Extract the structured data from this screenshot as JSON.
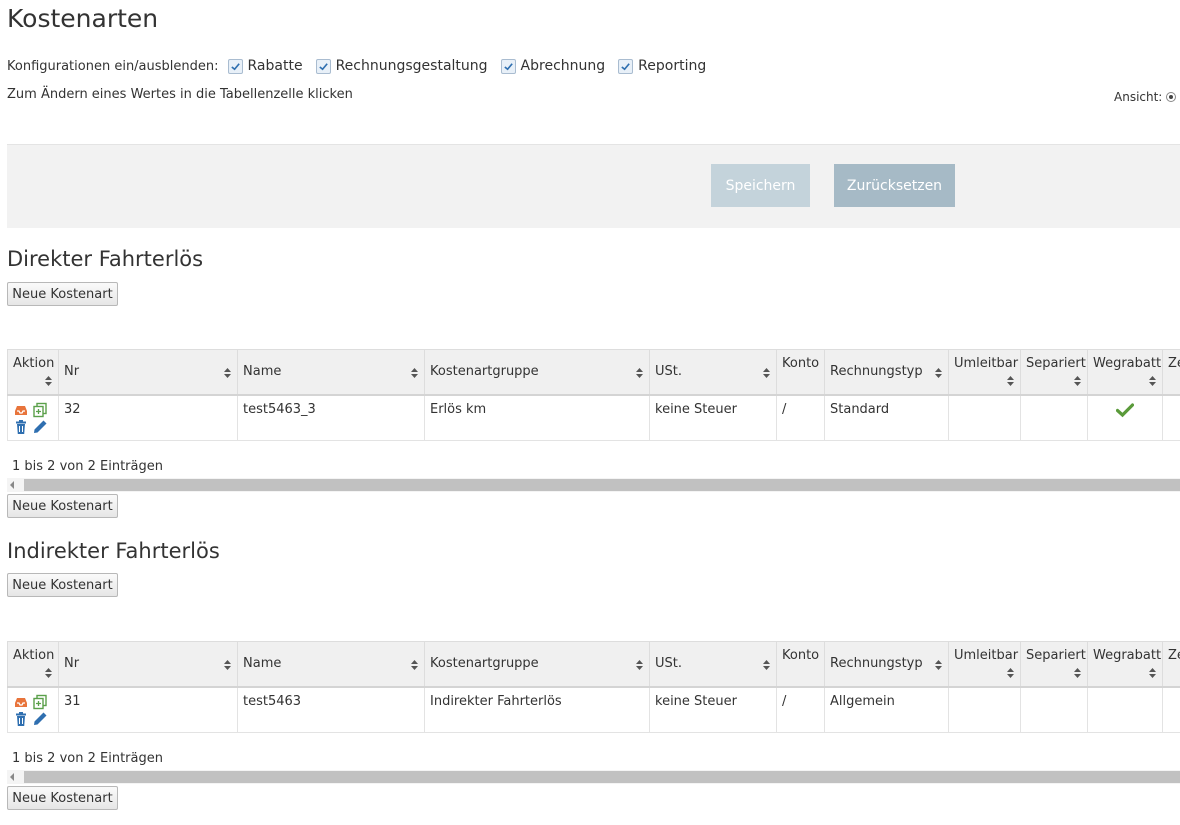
{
  "page": {
    "title": "Kostenarten",
    "config_label": "Konfigurationen ein/ausblenden:",
    "config_options": [
      {
        "label": "Rabatte",
        "checked": true
      },
      {
        "label": "Rechnungsgestaltung",
        "checked": true
      },
      {
        "label": "Abrechnung",
        "checked": true
      },
      {
        "label": "Reporting",
        "checked": true
      }
    ],
    "hint": "Zum Ändern eines Wertes in die Tabellenzelle klicken",
    "view_label": "Ansicht:"
  },
  "toolbar": {
    "save_label": "Speichern",
    "reset_label": "Zurücksetzen"
  },
  "colors": {
    "accent_check": "#5a9a3a",
    "icon_orange": "#e8743b",
    "icon_green": "#5aa04a",
    "icon_blue": "#2f6fb0",
    "save_btn": "#c4d3db",
    "reset_btn": "#a6bac6"
  },
  "columns": [
    "Aktion",
    "Nr",
    "Name",
    "Kostenartgruppe",
    "USt.",
    "Konto",
    "Rechnungstyp",
    "Umleitbar",
    "Separiert",
    "Wegrabatt",
    "Ze"
  ],
  "sections": [
    {
      "heading": "Direkter Fahrterlös",
      "new_button": "Neue Kostenart",
      "rows": [
        {
          "nr": "32",
          "name": "test5463_3",
          "group": "Erlös km",
          "ust": "keine Steuer",
          "konto": "/",
          "rechnungstyp": "Standard",
          "umleitbar": "",
          "separiert": "",
          "wegrabatt": true
        }
      ],
      "info": "1 bis 2 von 2 Einträgen",
      "new_button_bottom": "Neue Kostenart"
    },
    {
      "heading": "Indirekter Fahrterlös",
      "new_button": "Neue Kostenart",
      "rows": [
        {
          "nr": "31",
          "name": "test5463",
          "group": "Indirekter Fahrterlös",
          "ust": "keine Steuer",
          "konto": "/",
          "rechnungstyp": "Allgemein",
          "umleitbar": "",
          "separiert": "",
          "wegrabatt": false
        }
      ],
      "info": "1 bis 2 von 2 Einträgen",
      "new_button_bottom": "Neue Kostenart"
    }
  ]
}
